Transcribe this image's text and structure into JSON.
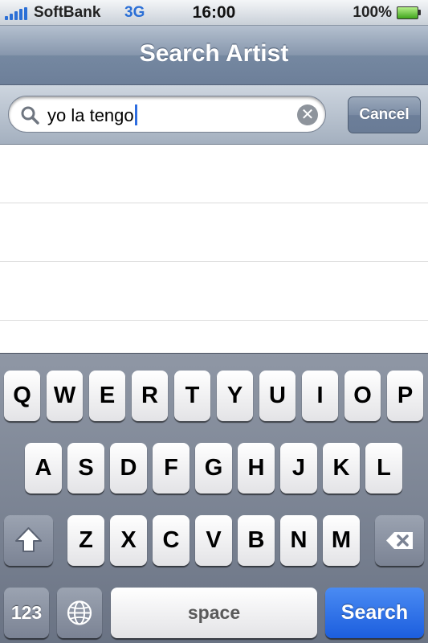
{
  "status_bar": {
    "carrier": "SoftBank",
    "network": "3G",
    "time": "16:00",
    "battery_percent": "100%"
  },
  "nav_bar": {
    "title": "Search Artist"
  },
  "search_bar": {
    "query": "yo la tengo",
    "cancel_label": "Cancel"
  },
  "results": {
    "rows": [
      "",
      "",
      ""
    ]
  },
  "keyboard": {
    "row1": [
      "Q",
      "W",
      "E",
      "R",
      "T",
      "Y",
      "U",
      "I",
      "O",
      "P"
    ],
    "row2": [
      "A",
      "S",
      "D",
      "F",
      "G",
      "H",
      "J",
      "K",
      "L"
    ],
    "row3": [
      "Z",
      "X",
      "C",
      "V",
      "B",
      "N",
      "M"
    ],
    "numbers_label": "123",
    "space_label": "space",
    "search_label": "Search"
  },
  "colors": {
    "accent_blue": "#2b6fd6",
    "search_key": "#1c5ede",
    "nav_bar": "#7588a1"
  }
}
